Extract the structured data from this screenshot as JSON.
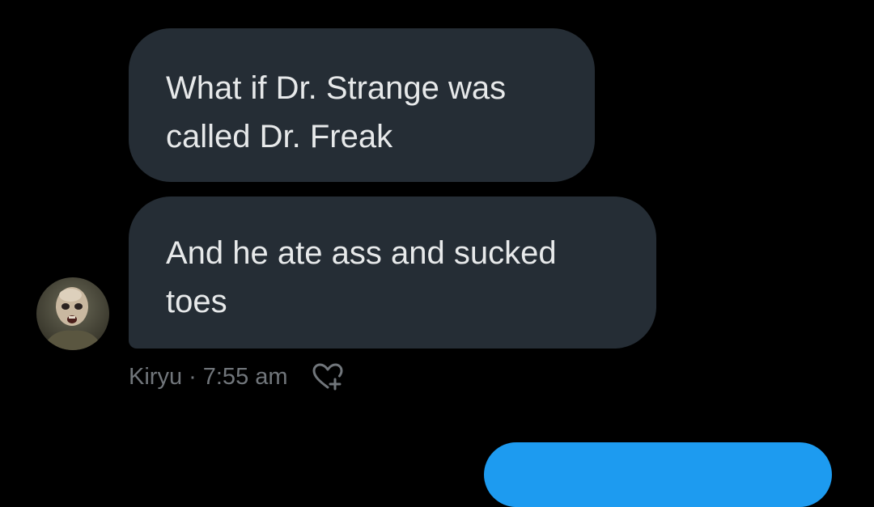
{
  "messages": [
    {
      "text": "What if Dr. Strange was\ncalled Dr. Freak"
    },
    {
      "text": "And he ate ass and sucked\ntoes"
    }
  ],
  "meta": {
    "sender": "Kiryu",
    "separator": "·",
    "time": "7:55 am",
    "reaction_icon": "heart-plus-icon"
  },
  "colors": {
    "background": "#000000",
    "incoming_bubble": "#252d35",
    "incoming_text": "#e7e9ea",
    "meta_text": "#71767b",
    "outgoing_bubble": "#1d9bf0"
  }
}
